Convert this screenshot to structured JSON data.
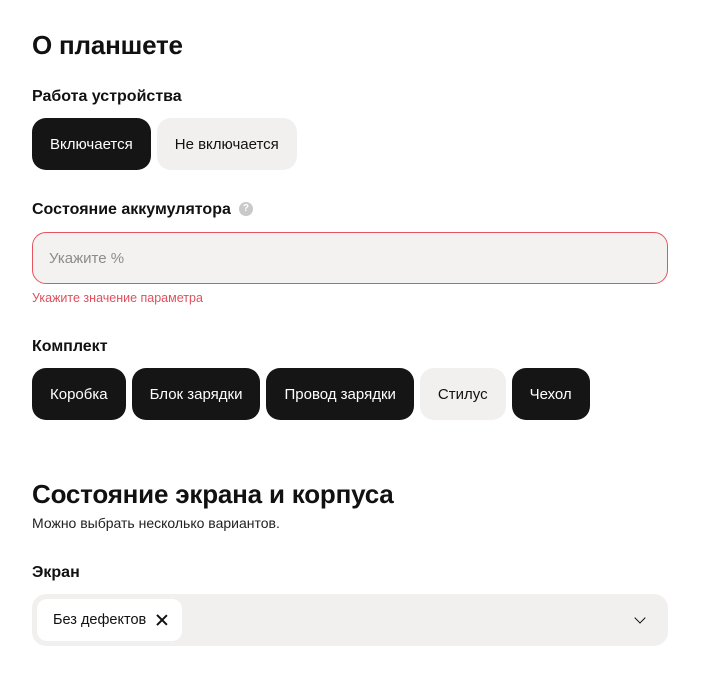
{
  "tablet": {
    "title": "О планшете",
    "work": {
      "label": "Работа устройства",
      "options": [
        {
          "label": "Включается",
          "selected": true
        },
        {
          "label": "Не включается",
          "selected": false
        }
      ]
    },
    "battery": {
      "label": "Состояние аккумулятора",
      "help_icon": "?",
      "placeholder": "Укажите %",
      "value": "",
      "error": "Укажите значение параметра"
    },
    "kit": {
      "label": "Комплект",
      "options": [
        {
          "label": "Коробка",
          "selected": true
        },
        {
          "label": "Блок зарядки",
          "selected": true
        },
        {
          "label": "Провод зарядки",
          "selected": true
        },
        {
          "label": "Стилус",
          "selected": false
        },
        {
          "label": "Чехол",
          "selected": true
        }
      ]
    }
  },
  "condition": {
    "title": "Состояние экрана и корпуса",
    "subtitle": "Можно выбрать несколько вариантов.",
    "screen": {
      "label": "Экран",
      "selected_tag": "Без дефектов"
    }
  },
  "colors": {
    "chip_selected": "#151515",
    "chip_unselected": "#f1f0ee",
    "error": "#e0505c"
  }
}
